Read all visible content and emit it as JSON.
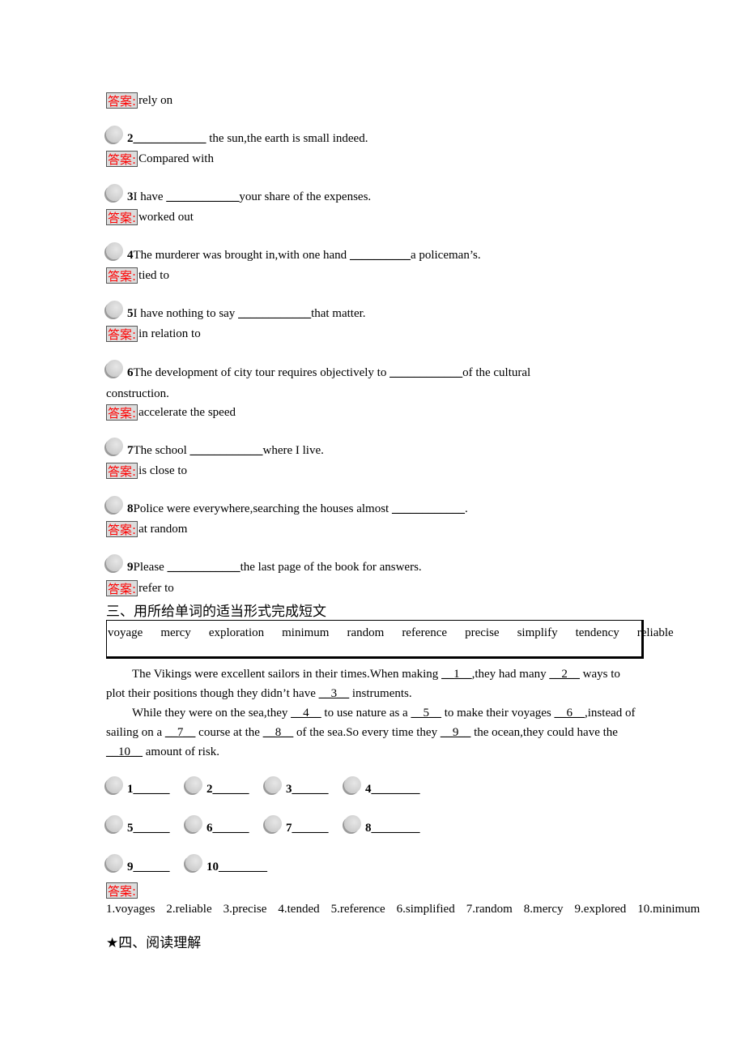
{
  "answer_label": "答案:",
  "questions": [
    {
      "answer": "rely on"
    },
    {
      "num": "2",
      "before": "",
      "blank": "____________",
      "after": " the sun,the earth is small indeed.",
      "answer": "Compared with"
    },
    {
      "num": "3",
      "before": "I have ",
      "blank": "____________",
      "after": "your share of the expenses.",
      "answer": "worked out"
    },
    {
      "num": "4",
      "before": "The murderer was brought in,with one hand ",
      "blank": "__________",
      "after": "a policeman’s.",
      "answer": "tied to"
    },
    {
      "num": "5",
      "before": "I have nothing to say ",
      "blank": "____________",
      "after": "that matter.",
      "answer": "in relation to"
    },
    {
      "num": "6",
      "before": "The development of city tour requires objectively to ",
      "blank": "____________",
      "after": "of the cultural",
      "continuation": "construction.",
      "answer": "accelerate the speed"
    },
    {
      "num": "7",
      "before": "The school ",
      "blank": "____________",
      "after": "where I live.",
      "answer": "is close to"
    },
    {
      "num": "8",
      "before": "Police were everywhere,searching the houses almost ",
      "blank": "____________",
      "after": ".",
      "answer": "at random"
    },
    {
      "num": "9",
      "before": "Please ",
      "blank": "____________",
      "after": "the last page of the book for answers.",
      "answer": "refer to"
    }
  ],
  "section3": {
    "title": "三、用所给单词的适当形式完成短文",
    "words": [
      "voyage",
      "mercy",
      "exploration",
      "minimum",
      "random",
      "reference",
      "precise",
      "simplify",
      "tendency",
      "reliable"
    ],
    "passage": {
      "p1": {
        "t1": "The Vikings were excellent sailors in their times.When making ",
        "b1": "__1__",
        "t2": ",they had many ",
        "b2": "__2__",
        "t3": " ways to plot their positions though they didn’t have ",
        "b3": "__3__",
        "t4": " instruments."
      },
      "p2": {
        "t1": "While they were on the sea,they ",
        "b4": "__4__",
        "t2": " to use nature as a ",
        "b5": "__5__",
        "t3": " to make their voyages ",
        "b6": "__6__",
        "t4": ",instead of sailing on a ",
        "b7": "__7__",
        "t5": " course at the ",
        "b8": "__8__",
        "t6": " of the sea.So every time they ",
        "b9": "__9__",
        "t7": " the ocean,they could have the ",
        "b10": "__10__",
        "t8": " amount of risk."
      }
    },
    "blanks": [
      {
        "num": "1",
        "line": "______"
      },
      {
        "num": "2",
        "line": "______"
      },
      {
        "num": "3",
        "line": "______"
      },
      {
        "num": "4",
        "line": "________"
      },
      {
        "num": "5",
        "line": "______"
      },
      {
        "num": "6",
        "line": "______"
      },
      {
        "num": "7",
        "line": "______"
      },
      {
        "num": "8",
        "line": "________"
      },
      {
        "num": "9",
        "line": "______"
      },
      {
        "num": "10",
        "line": "________"
      }
    ],
    "answers": [
      "1.voyages",
      "2.reliable",
      "3.precise",
      "4.tended",
      "5.reference",
      "6.simplified",
      "7.random",
      "8.mercy",
      "9.explored",
      "10.minimum"
    ]
  },
  "section4": {
    "title": "★四、阅读理解"
  }
}
